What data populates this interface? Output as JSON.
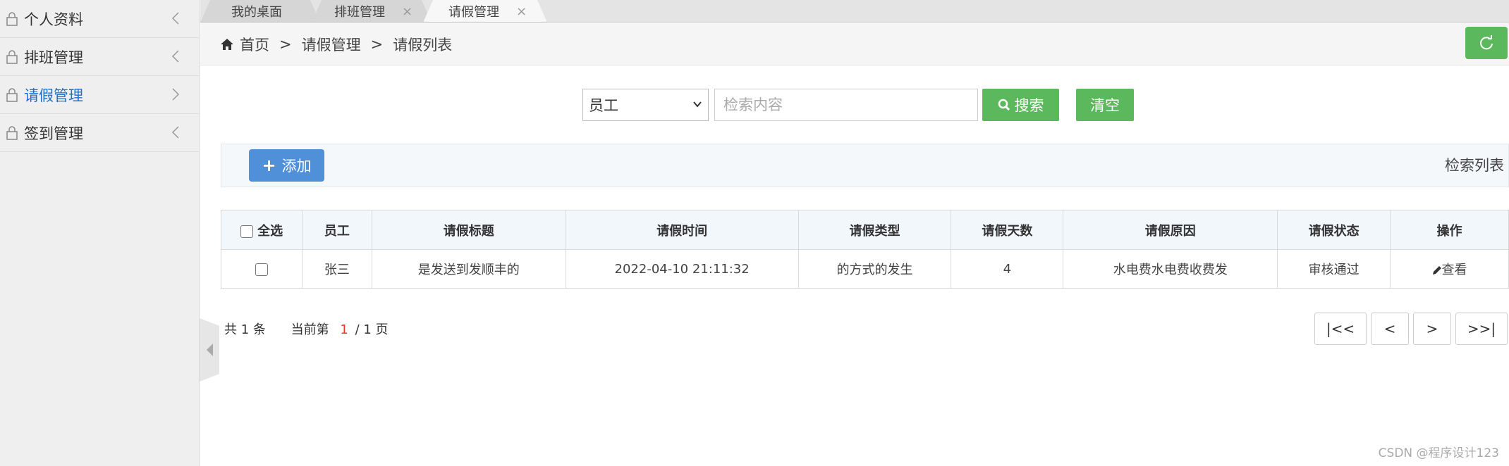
{
  "sidebar": {
    "items": [
      {
        "label": "个人资料",
        "icon": "lock-icon",
        "chevron": "chevron-left-icon"
      },
      {
        "label": "排班管理",
        "icon": "lock-icon",
        "chevron": "chevron-left-icon"
      },
      {
        "label": "请假管理",
        "icon": "lock-icon",
        "chevron": "chevron-right-icon",
        "active": true
      },
      {
        "label": "签到管理",
        "icon": "lock-icon",
        "chevron": "chevron-left-icon"
      }
    ],
    "active_color": "#1e6fc7"
  },
  "tabs": [
    {
      "label": "我的桌面",
      "closable": false
    },
    {
      "label": "排班管理",
      "closable": true,
      "close": "×"
    },
    {
      "label": "请假管理",
      "closable": true,
      "close": "×",
      "active": true
    }
  ],
  "breadcrumb": {
    "home": "首页",
    "sep": ">",
    "section": "请假管理",
    "page": "请假列表"
  },
  "search": {
    "field_selected": "员工",
    "placeholder": "检索内容",
    "search_label": "搜索",
    "clear_label": "清空"
  },
  "toolbar": {
    "add_label": "添加",
    "list_title": "检索列表"
  },
  "table": {
    "select_all": "全选",
    "columns": [
      "员工",
      "请假标题",
      "请假时间",
      "请假类型",
      "请假天数",
      "请假原因",
      "请假状态",
      "操作"
    ],
    "rows": [
      {
        "employee": "张三",
        "title": "是发送到发顺丰的",
        "time": "2022-04-10 21:11:32",
        "type": "的方式的发生",
        "days": "4",
        "reason": "水电费水电费收费发",
        "status": "审核通过",
        "action": "查看"
      }
    ]
  },
  "pager": {
    "total": "共 1 条",
    "current_prefix": "当前第",
    "current": "1",
    "suffix": "/ 1 页",
    "first": "|<<",
    "prev": "<",
    "next": ">",
    "last": ">>|"
  },
  "watermark": "CSDN @程序设计123",
  "colors": {
    "green": "#5cb85c",
    "blue": "#4f90d9",
    "red": "#e33"
  }
}
